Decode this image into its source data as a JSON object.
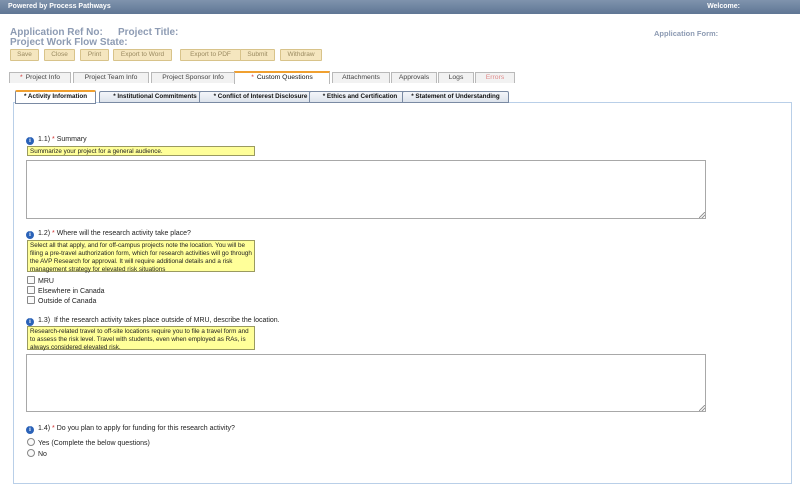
{
  "topbar": {
    "powered": "Powered by Process Pathways",
    "welcome": "Welcome:"
  },
  "header": {
    "app_ref": "Application Ref No:",
    "project_title": "Project Title:",
    "workflow_state": "Project Work Flow State:",
    "application_form": "Application Form:"
  },
  "toolbar": {
    "save": "Save",
    "close": "Close",
    "print": "Print",
    "export_word": "Export to Word",
    "export_pdf": "Export to PDF",
    "submit": "Submit",
    "withdraw": "Withdraw"
  },
  "main_tabs": {
    "project_info": "Project Info",
    "project_team_info": "Project Team Info",
    "project_sponsor_info": "Project Sponsor Info",
    "custom_questions": "Custom Questions",
    "attachments": "Attachments",
    "approvals": "Approvals",
    "logs": "Logs",
    "errors": "Errors",
    "star": "*"
  },
  "sub_tabs": {
    "activity_information": "* Activity Information",
    "institutional_commitments": "* Institutional Commitments",
    "conflict_of_interest": "* Conflict of Interest Disclosure",
    "ethics_certification": "* Ethics and Certification",
    "statement_understanding": "* Statement of Understanding"
  },
  "questions": {
    "q1": {
      "number": "1.1)",
      "req": "*",
      "label": "Summary",
      "hint": "Summarize your project for a general audience."
    },
    "q2": {
      "number": "1.2)",
      "req": "*",
      "label": "Where will the research activity take place?",
      "hint": "Select all that apply, and for off-campus projects note the location. You will be filing a pre-travel authorization form, which for research activities will go through the AVP Research for approval. It will require additional details and a risk management strategy for elevated risk situations",
      "options": [
        "MRU",
        "Elsewhere in Canada",
        "Outside of Canada"
      ]
    },
    "q3": {
      "number": "1.3)",
      "label": "If the research activity takes place outside of MRU, describe the location.",
      "hint": "Research-related travel to off-site locations require you to file a travel form and to assess the risk level. Travel with students, even when employed as RAs, is always considered elevated risk."
    },
    "q4": {
      "number": "1.4)",
      "req": "*",
      "label": "Do you plan to apply for funding for this research activity?",
      "options": [
        "Yes (Complete the below questions)",
        "No"
      ]
    }
  },
  "icons": {
    "info": "info-icon"
  },
  "colors": {
    "accent_tab": "#f0a030",
    "header_text": "#8d9bb3",
    "hint_bg": "#ffff99",
    "required": "#d03030"
  }
}
